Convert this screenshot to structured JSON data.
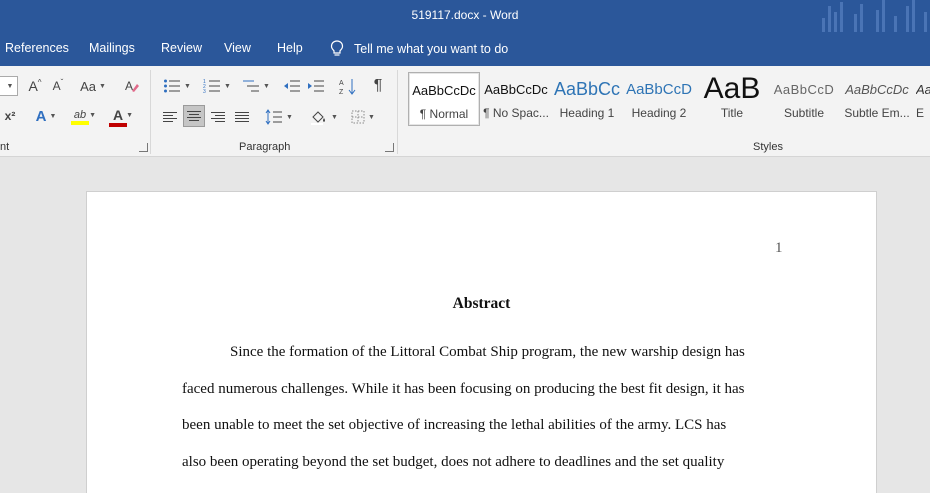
{
  "window": {
    "title": "519117.docx  -  Word"
  },
  "menu": {
    "items": [
      "References",
      "Mailings",
      "Review",
      "View",
      "Help"
    ],
    "tell_me": "Tell me what you want to do"
  },
  "ribbon": {
    "font_group": {
      "label": "nt",
      "grow_icon": "A",
      "shrink_icon": "A",
      "case_icon": "Aa",
      "superscript_icon": "x²",
      "effects_icon": "A",
      "highlight_icon": "ab",
      "font_color_icon": "A",
      "font_color": "#c00000",
      "highlight_color": "#ffff00"
    },
    "paragraph_group": {
      "label": "Paragraph",
      "pilcrow": "¶"
    },
    "styles_group": {
      "label": "Styles",
      "items": [
        {
          "sample": "AaBbCcDc",
          "name": "¶ Normal"
        },
        {
          "sample": "AaBbCcDc",
          "name": "¶ No Spac..."
        },
        {
          "sample": "AaBbCc",
          "name": "Heading 1"
        },
        {
          "sample": "AaBbCcD",
          "name": "Heading 2"
        },
        {
          "sample": "AaB",
          "name": "Title"
        },
        {
          "sample": "AaBbCcD",
          "name": "Subtitle"
        },
        {
          "sample": "AaBbCcDc",
          "name": "Subtle Em..."
        },
        {
          "sample": "Aa",
          "name": "E"
        }
      ]
    }
  },
  "document": {
    "page_number": "1",
    "heading": "Abstract",
    "lines": [
      "Since the formation of the Littoral Combat Ship program, the new warship design has",
      "faced numerous challenges. While it has been focusing on producing the best fit design, it has",
      "been unable to meet the set objective of increasing the lethal abilities of the army. LCS has",
      "also been operating beyond the set budget, does not adhere to deadlines and the set quality"
    ]
  },
  "colors": {
    "brand": "#2b579a",
    "ribbon_bg": "#f3f3f3",
    "canvas": "#e6e6e6"
  }
}
